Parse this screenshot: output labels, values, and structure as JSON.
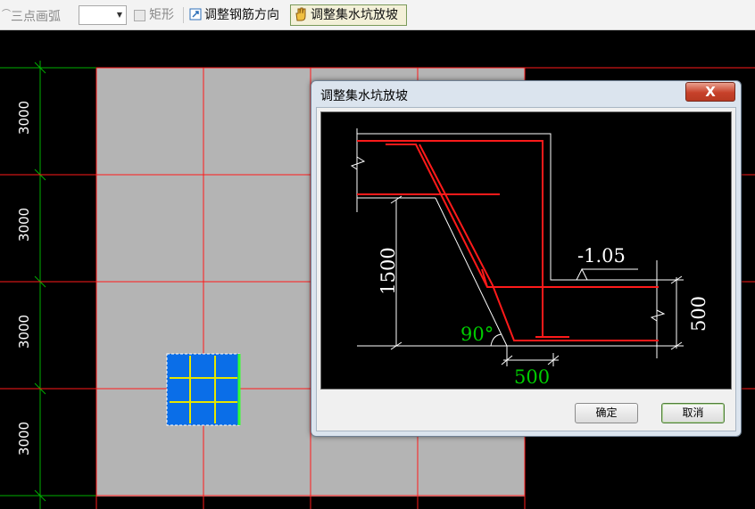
{
  "toolbar": {
    "arc_tool": "三点画弧",
    "combo_value": "",
    "rect_label": "矩形",
    "adjust_rebar_label": "调整钢筋方向",
    "adjust_slope_label": "调整集水坑放坡"
  },
  "canvas": {
    "row_dimensions": [
      "3000",
      "3000",
      "3000",
      "3000"
    ]
  },
  "dialog": {
    "title": "调整集水坑放坡",
    "close_label": "X",
    "ok_label": "确定",
    "cancel_label": "取消",
    "diagram": {
      "depth": "1500",
      "elevation": "-1.05",
      "angle": "90°",
      "bottom_width": "500",
      "side_height": "500"
    }
  },
  "colors": {
    "background": "#000000",
    "slab_fill": "#b4b4b4",
    "axis_red": "#ff0000",
    "dim_green": "#00cc00",
    "pit_fill": "#0a6ee8",
    "rebar_yellow": "#e6e600"
  }
}
